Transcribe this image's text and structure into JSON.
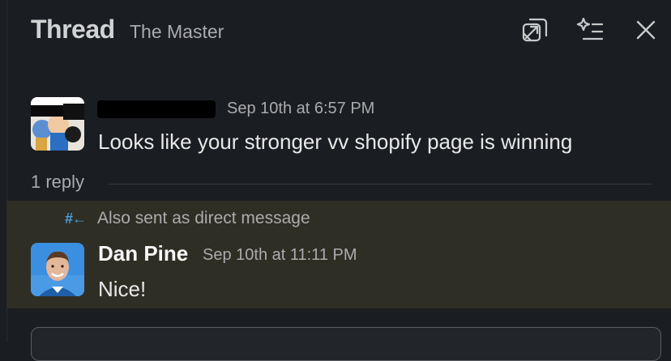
{
  "header": {
    "title": "Thread",
    "channel": "The Master",
    "icons": [
      "open-in-window-icon",
      "ai-summary-icon",
      "close-icon"
    ]
  },
  "parent_message": {
    "author": "",
    "author_redacted": true,
    "timestamp": "Sep 10th at 6:57 PM",
    "text": "Looks like your stronger vv shopify page is winning"
  },
  "replies": {
    "count_label": "1 reply"
  },
  "reply_message": {
    "also_sent_icon": "hash-arrow-icon",
    "also_sent_label": "Also sent as direct message",
    "author": "Dan Pine",
    "timestamp": "Sep 10th at 11:11 PM",
    "text": "Nice!"
  },
  "colors": {
    "background": "#1a1d21",
    "highlight": "#2f2e25",
    "accent_blue": "#4a9fd8",
    "muted_text": "#ababad"
  }
}
